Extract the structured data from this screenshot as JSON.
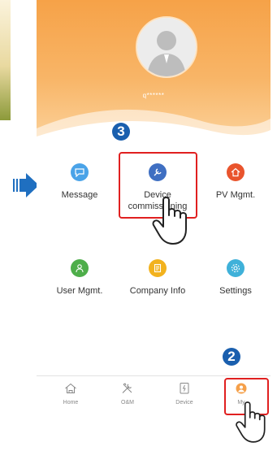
{
  "profile": {
    "username": "q******"
  },
  "grid": [
    {
      "label": "Message",
      "color": "#4aa3e8",
      "icon": "message-icon"
    },
    {
      "label": "Device commissioning",
      "color": "#3f6fc2",
      "icon": "device-commissioning-icon"
    },
    {
      "label": "PV Mgmt.",
      "color": "#e9542d",
      "icon": "pv-mgmt-icon"
    },
    {
      "label": "User Mgmt.",
      "color": "#4eae4a",
      "icon": "user-mgmt-icon"
    },
    {
      "label": "Company Info",
      "color": "#f2b21e",
      "icon": "company-info-icon"
    },
    {
      "label": "Settings",
      "color": "#3fb1d9",
      "icon": "settings-icon"
    }
  ],
  "tabs": [
    {
      "label": "Home",
      "icon": "home-icon"
    },
    {
      "label": "O&M",
      "icon": "tools-icon"
    },
    {
      "label": "Device",
      "icon": "device-icon"
    },
    {
      "label": "My",
      "icon": "my-icon",
      "active_color": "#f5a04a"
    }
  ],
  "annotations": {
    "step_device": "3",
    "step_my": "2",
    "highlight_color": "#e02020",
    "badge_color": "#1a5fae",
    "arrow_color": "#1f6fc0"
  }
}
